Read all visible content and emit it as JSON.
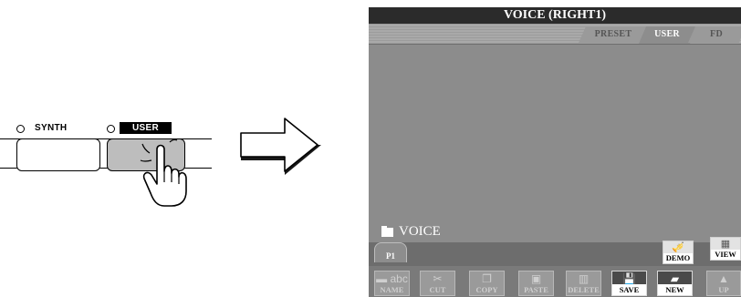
{
  "panel": {
    "synth_label": "SYNTH",
    "user_label": "USER"
  },
  "screen": {
    "title": "VOICE (RIGHT1)",
    "tabs": [
      {
        "label": "PRESET",
        "active": false
      },
      {
        "label": "USER",
        "active": true
      },
      {
        "label": "FD",
        "active": false
      }
    ],
    "folder_name": "VOICE",
    "page_tab": "P1",
    "side_buttons": [
      {
        "label": "DEMO",
        "icon": "trumpet-icon"
      },
      {
        "label": "VIEW",
        "icon": "view-grid-icon"
      }
    ],
    "toolbar": [
      {
        "label": "NAME",
        "icon": "name-abc-icon",
        "active": false
      },
      {
        "label": "CUT",
        "icon": "scissors-icon",
        "active": false
      },
      {
        "label": "COPY",
        "icon": "copy-icon",
        "active": false
      },
      {
        "label": "PASTE",
        "icon": "paste-icon",
        "active": false
      },
      {
        "label": "DELETE",
        "icon": "trash-icon",
        "active": false
      },
      {
        "label": "SAVE",
        "icon": "floppy-icon",
        "active": true
      },
      {
        "label": "NEW",
        "icon": "new-folder-icon",
        "active": true
      },
      {
        "label": "UP",
        "icon": "folder-up-icon",
        "active": false
      }
    ]
  }
}
